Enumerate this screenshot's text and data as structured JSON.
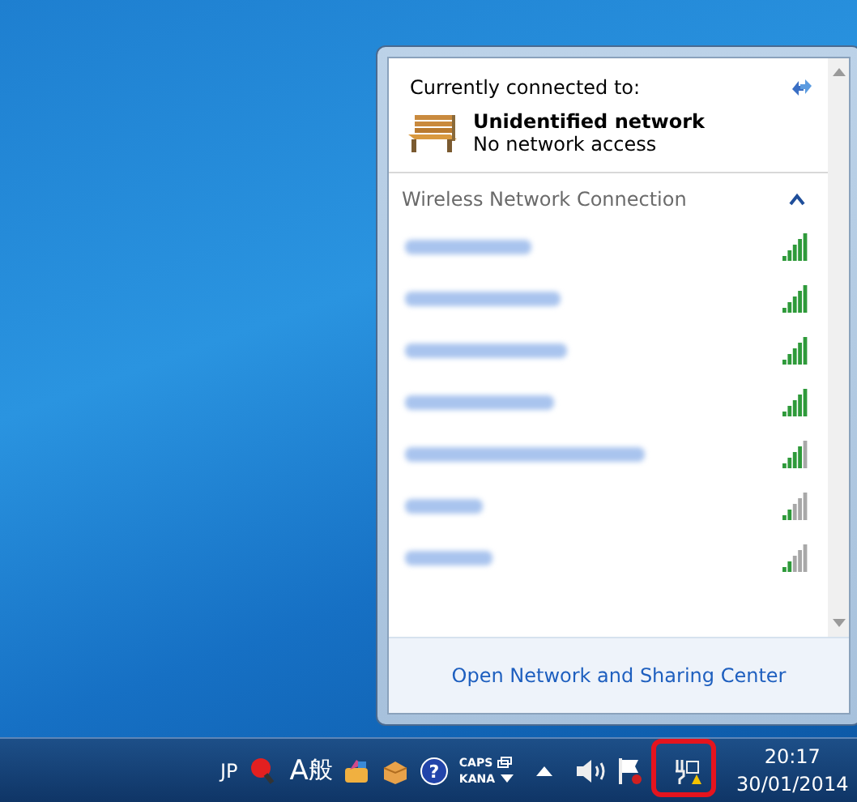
{
  "flyout": {
    "header": {
      "title": "Currently connected to:",
      "network_name": "Unidentified network",
      "network_status": "No network access"
    },
    "section": {
      "title": "Wireless Network Connection",
      "expanded": true
    },
    "networks": [
      {
        "kind": "full"
      },
      {
        "kind": "full"
      },
      {
        "kind": "full"
      },
      {
        "kind": "full"
      },
      {
        "kind": "good"
      },
      {
        "kind": "weak"
      },
      {
        "kind": "weak"
      }
    ],
    "footer_link": "Open Network and Sharing Center"
  },
  "taskbar": {
    "language": "JP",
    "ime_label": "A",
    "ime_mode": "般",
    "caps": "CAPS",
    "kana": "KANA",
    "help_glyph": "?",
    "time": "20:17",
    "date": "30/01/2014",
    "highlight": true
  }
}
